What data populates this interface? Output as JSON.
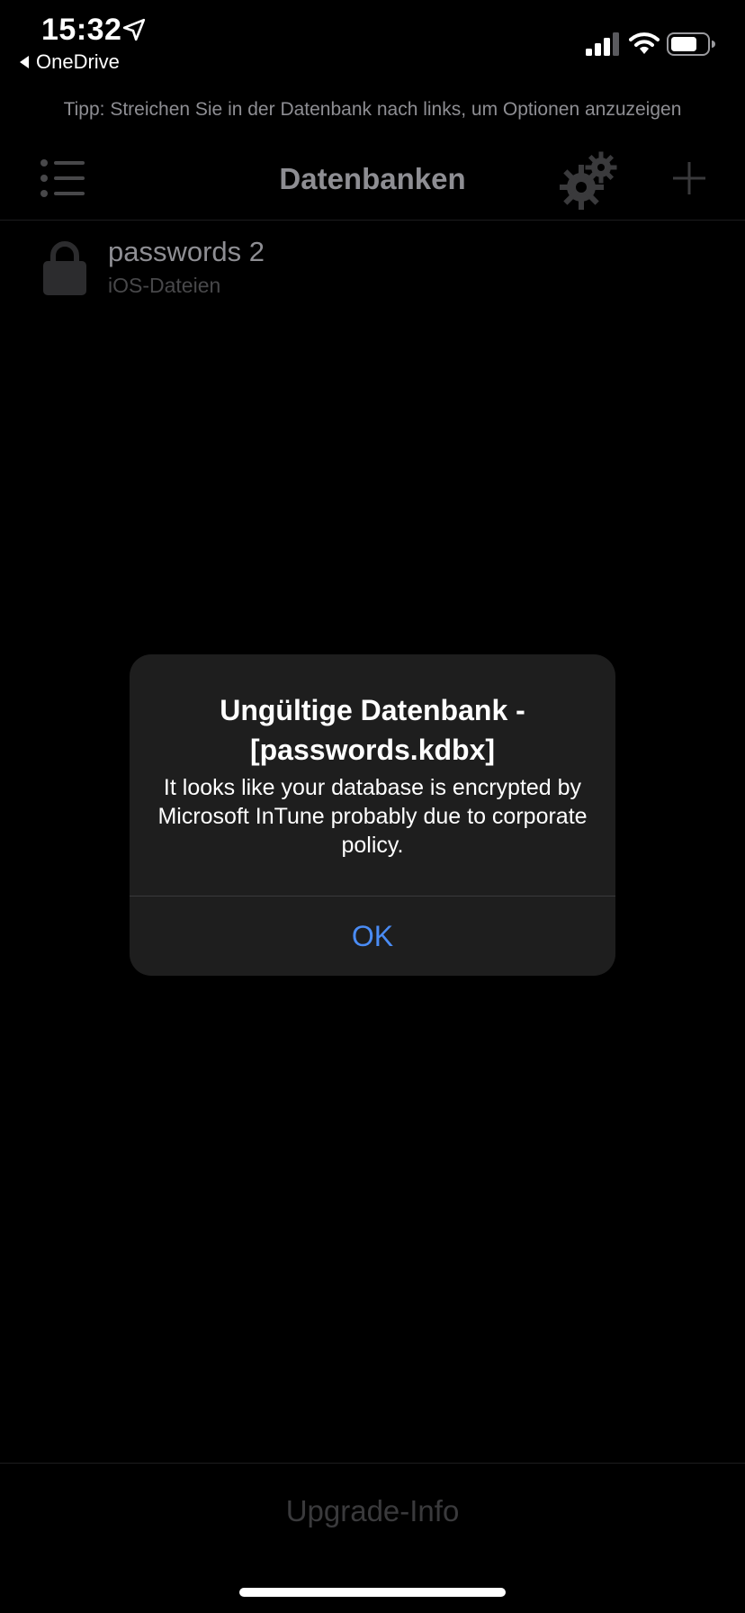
{
  "status_bar": {
    "time": "15:32",
    "back_app": "OneDrive",
    "icons": [
      "location-arrow-icon",
      "back-caret-icon",
      "cellular-signal-icon",
      "wifi-icon",
      "battery-icon"
    ]
  },
  "tip": "Tipp: Streichen Sie in der Datenbank nach links, um Optionen anzuzeigen",
  "navbar": {
    "title": "Datenbanken",
    "icons": [
      "list-icon",
      "gear-icon",
      "plus-icon"
    ]
  },
  "databases": [
    {
      "name": "passwords 2",
      "source": "iOS-Dateien",
      "icon": "lock-icon"
    }
  ],
  "alert": {
    "title": "Ungültige Datenbank - [passwords.kdbx]",
    "message": "It looks like your database is encrypted by Microsoft InTune probably due to corporate policy.",
    "ok_label": "OK"
  },
  "footer": {
    "upgrade_label": "Upgrade-Info"
  },
  "colors": {
    "background": "#000000",
    "alert_background": "#1e1e1e",
    "accent": "#4a8cf5",
    "secondary_text": "#8e8e93"
  }
}
